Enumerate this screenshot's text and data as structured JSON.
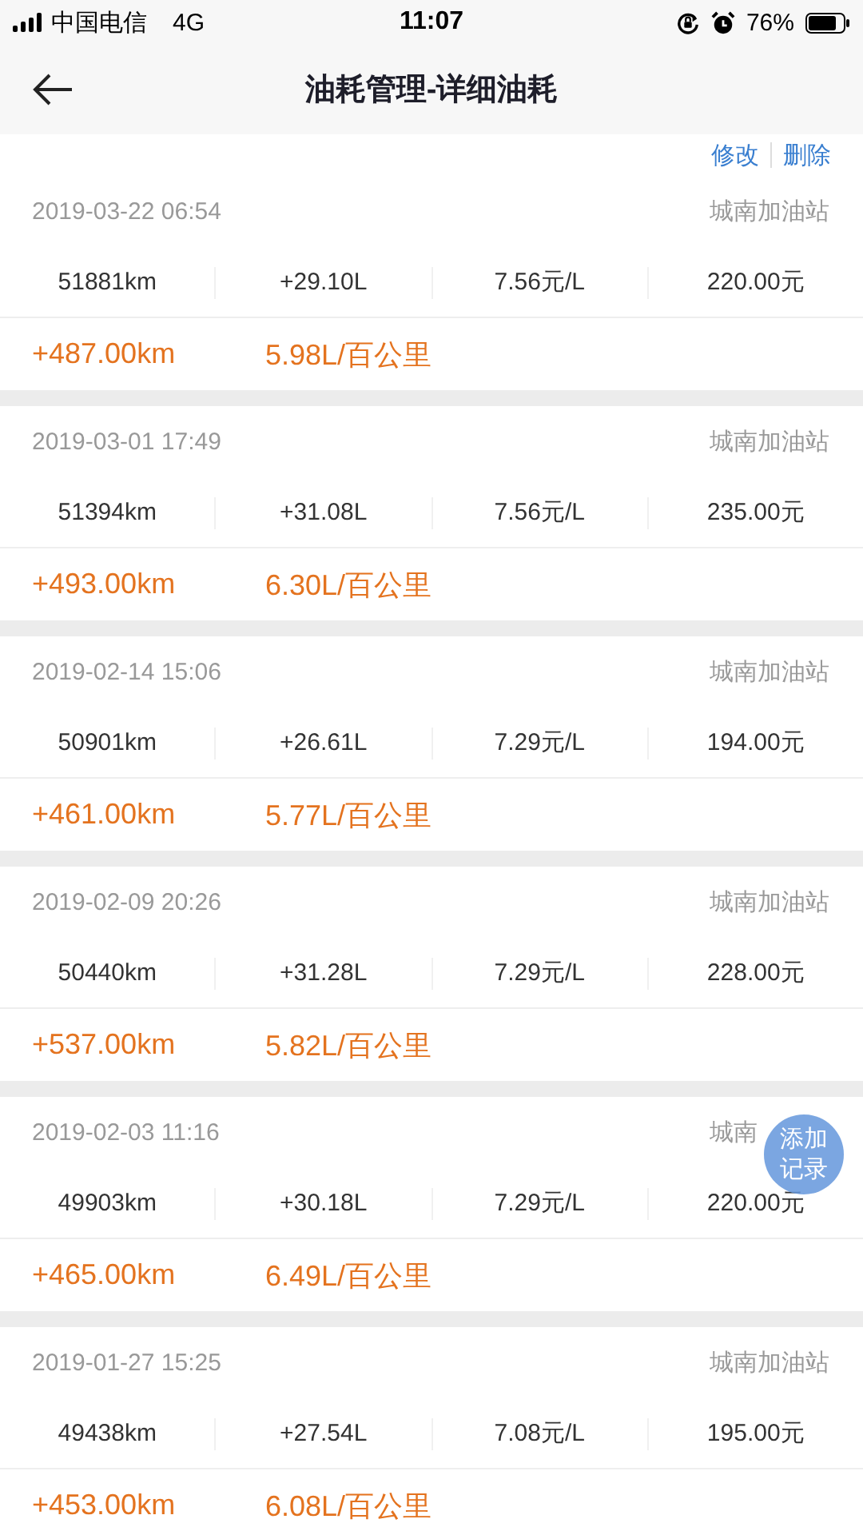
{
  "status_bar": {
    "carrier": "中国电信",
    "network": "4G",
    "time": "11:07",
    "battery": "76%"
  },
  "header": {
    "title": "油耗管理-详细油耗"
  },
  "actions": [
    "修改",
    "删除"
  ],
  "records": [
    {
      "datetime": "2019-03-22 06:54",
      "station": "城南加油站",
      "odometer": "51881km",
      "fuel": "+29.10L",
      "price": "7.56元/L",
      "amount": "220.00元",
      "distance": "+487.00km",
      "consumption": "5.98L/百公里"
    },
    {
      "datetime": "2019-03-01 17:49",
      "station": "城南加油站",
      "odometer": "51394km",
      "fuel": "+31.08L",
      "price": "7.56元/L",
      "amount": "235.00元",
      "distance": "+493.00km",
      "consumption": "6.30L/百公里"
    },
    {
      "datetime": "2019-02-14 15:06",
      "station": "城南加油站",
      "odometer": "50901km",
      "fuel": "+26.61L",
      "price": "7.29元/L",
      "amount": "194.00元",
      "distance": "+461.00km",
      "consumption": "5.77L/百公里"
    },
    {
      "datetime": "2019-02-09 20:26",
      "station": "城南加油站",
      "odometer": "50440km",
      "fuel": "+31.28L",
      "price": "7.29元/L",
      "amount": "228.00元",
      "distance": "+537.00km",
      "consumption": "5.82L/百公里"
    },
    {
      "datetime": "2019-02-03 11:16",
      "station": "城南",
      "odometer": "49903km",
      "fuel": "+30.18L",
      "price": "7.29元/L",
      "amount": "220.00元",
      "distance": "+465.00km",
      "consumption": "6.49L/百公里"
    },
    {
      "datetime": "2019-01-27 15:25",
      "station": "城南加油站",
      "odometer": "49438km",
      "fuel": "+27.54L",
      "price": "7.08元/L",
      "amount": "195.00元",
      "distance": "+453.00km",
      "consumption": "6.08L/百公里"
    }
  ],
  "fab": {
    "label": "添加记录"
  }
}
